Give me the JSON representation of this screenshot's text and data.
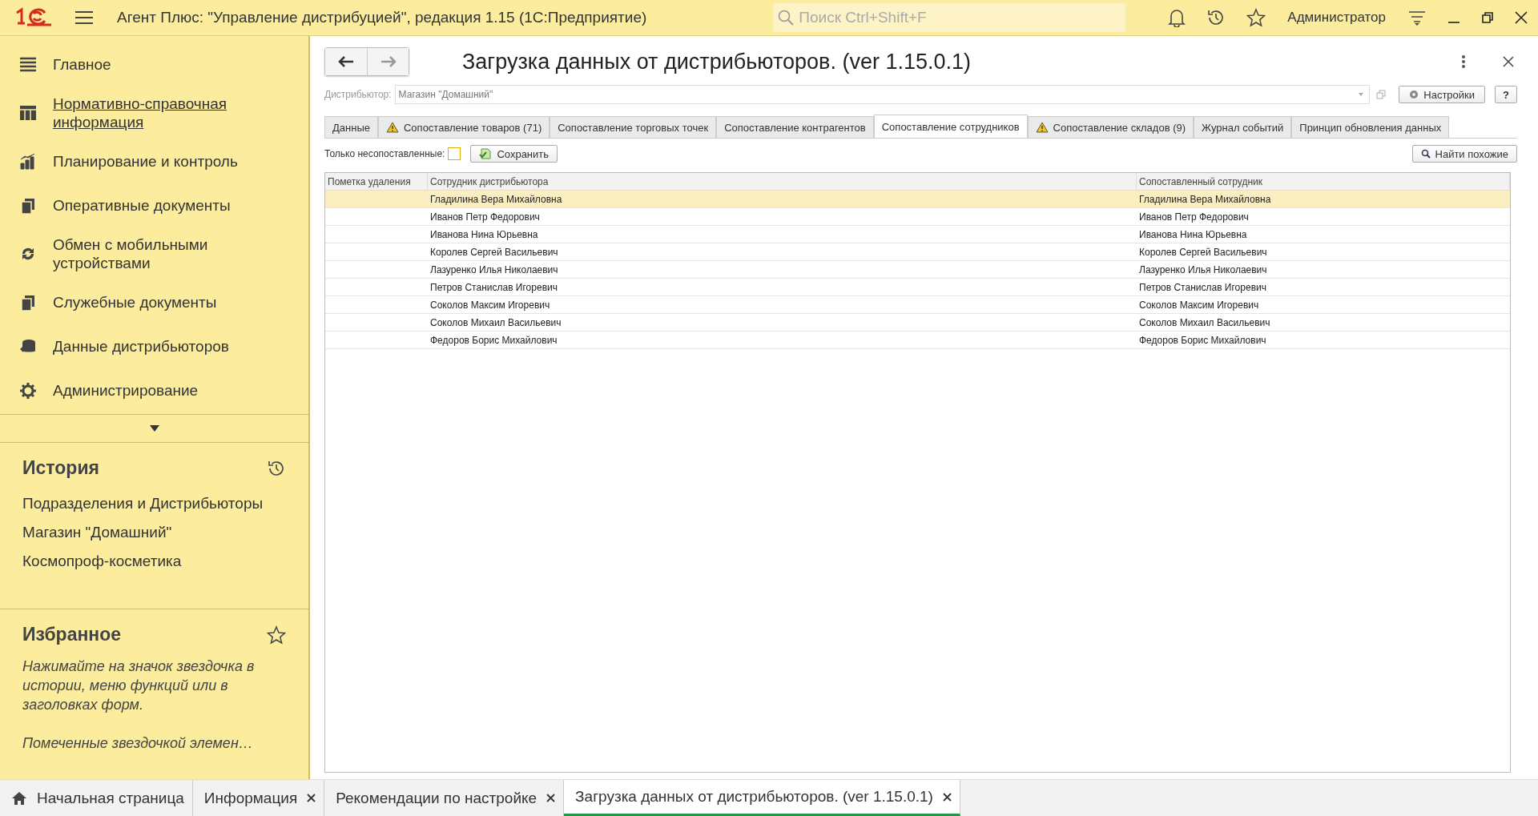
{
  "app_title": "Агент Плюс: \"Управление дистрибуцией\", редакция 1.15  (1С:Предприятие)",
  "search": {
    "placeholder": "Поиск Ctrl+Shift+F"
  },
  "user": "Администратор",
  "nav": [
    {
      "label": "Главное",
      "kind": "menu",
      "underlined": false
    },
    {
      "label": "Нормативно-справочная информация",
      "kind": "grid",
      "underlined": true
    },
    {
      "label": "Планирование и контроль",
      "kind": "chart",
      "underlined": false
    },
    {
      "label": "Оперативные документы",
      "kind": "docs",
      "underlined": false
    },
    {
      "label": "Обмен с мобильными устройствами",
      "kind": "sync",
      "underlined": false
    },
    {
      "label": "Служебные документы",
      "kind": "docs",
      "underlined": false
    },
    {
      "label": "Данные дистрибьюторов",
      "kind": "data",
      "underlined": false
    },
    {
      "label": "Администрирование",
      "kind": "gear",
      "underlined": false
    }
  ],
  "history": {
    "title": "История",
    "items": [
      "Подразделения и Дистрибьюторы",
      "Магазин \"Домашний\"",
      "Космопроф-косметика"
    ]
  },
  "favorites": {
    "title": "Избранное",
    "hint": "Нажимайте на значок звездочка в истории, меню функций или в заголовках форм.",
    "note": "Помеченные звездочкой элемен…"
  },
  "form": {
    "title": "Загрузка данных от дистрибьюторов. (ver 1.15.0.1)",
    "distributor_label": "Дистрибьютор:",
    "distributor_value": "Магазин \"Домашний\"",
    "settings_button": "Настройки",
    "help_button": "?",
    "tabs": [
      {
        "label": "Данные",
        "warning": false,
        "selected": false
      },
      {
        "label": "Сопоставление товаров (71)",
        "warning": true,
        "selected": false
      },
      {
        "label": "Сопоставление торговых точек",
        "warning": false,
        "selected": false
      },
      {
        "label": "Сопоставление контрагентов",
        "warning": false,
        "selected": false
      },
      {
        "label": "Сопоставление сотрудников",
        "warning": false,
        "selected": true
      },
      {
        "label": "Сопоставление складов (9)",
        "warning": true,
        "selected": false
      },
      {
        "label": "Журнал событий",
        "warning": false,
        "selected": false
      },
      {
        "label": "Принцип обновления данных",
        "warning": false,
        "selected": false
      }
    ],
    "only_unmatched_label": "Только несопоставленные:",
    "only_unmatched": false,
    "save_button": "Сохранить",
    "find_button": "Найти похожие",
    "table": {
      "columns": [
        "Пометка удаления",
        "Сотрудник дистрибьютора",
        "Сопоставленный сотрудник"
      ],
      "rows": [
        {
          "employee": "Гладилина Вера Михайловна",
          "matched": "Гладилина Вера Михайловна",
          "selected": true
        },
        {
          "employee": "Иванов Петр Федорович",
          "matched": "Иванов Петр Федорович",
          "selected": false
        },
        {
          "employee": "Иванова Нина Юрьевна",
          "matched": "Иванова Нина Юрьевна",
          "selected": false
        },
        {
          "employee": "Королев Сергей Васильевич",
          "matched": "Королев Сергей Васильевич",
          "selected": false
        },
        {
          "employee": "Лазуренко Илья Николаевич",
          "matched": "Лазуренко Илья Николаевич",
          "selected": false
        },
        {
          "employee": "Петров Станислав Игоревич",
          "matched": "Петров Станислав Игоревич",
          "selected": false
        },
        {
          "employee": "Соколов Максим Игоревич",
          "matched": "Соколов Максим Игоревич",
          "selected": false
        },
        {
          "employee": "Соколов Михаил Васильевич",
          "matched": "Соколов Михаил Васильевич",
          "selected": false
        },
        {
          "employee": "Федоров Борис Михайлович",
          "matched": "Федоров Борис Михайлович",
          "selected": false
        }
      ]
    }
  },
  "open_tabs": [
    {
      "label": "Начальная страница",
      "home": true,
      "closable": false,
      "selected": false
    },
    {
      "label": "Информация",
      "home": false,
      "closable": true,
      "selected": false
    },
    {
      "label": "Рекомендации по настройке",
      "home": false,
      "closable": true,
      "selected": false
    },
    {
      "label": "Загрузка данных от дистрибьюторов. (ver 1.15.0.1)",
      "home": false,
      "closable": true,
      "selected": true
    }
  ]
}
